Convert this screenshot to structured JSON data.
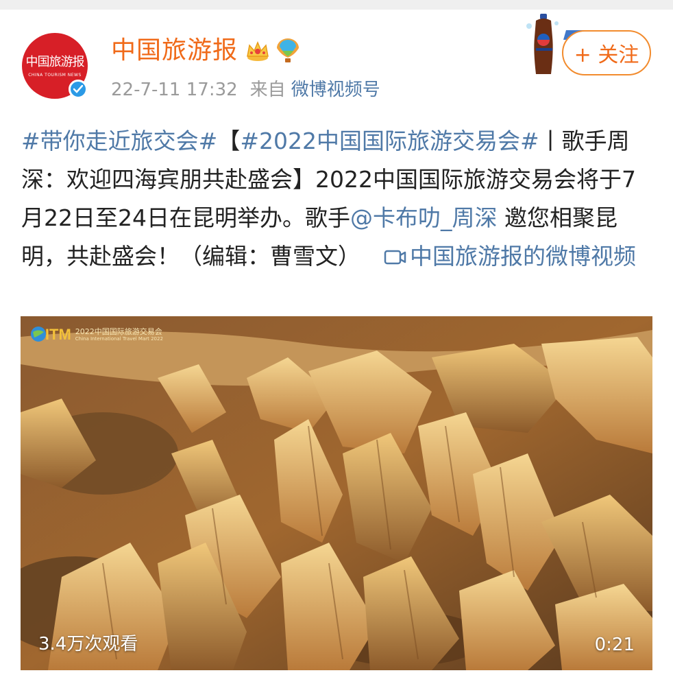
{
  "header": {
    "account_name": "中国旅游报",
    "avatar_text": "中国旅游报",
    "avatar_subtext": "CHINA TOURISM NEWS",
    "time": "22-7-11 17:32",
    "source_prefix": "来自",
    "source": "微博视频号",
    "follow_label": "+ 关注"
  },
  "post": {
    "topic1": "#带你走近旅交会#",
    "bracket_open": "【",
    "topic2": "#2022中国国际旅游交易会#",
    "headline_rest": "丨歌手周深：欢迎四海宾朋共赴盛会】",
    "body": "2022中国国际旅游交易会将于7月22日至24日在昆明举办。歌手",
    "mention": "@卡布叻_周深",
    "body2": " 邀您相聚昆明，共赴盛会！（编辑：曹雪文）",
    "video_link": "中国旅游报的微博视频"
  },
  "video": {
    "watermark_logo": "CITM",
    "watermark_cn": "2022中国国际旅游交易会",
    "watermark_en": "China International Travel Mart 2022",
    "views": "3.4万次观看",
    "duration": "0:21"
  },
  "colors": {
    "name_orange": "#f06a19",
    "link_blue": "#4f79a7",
    "meta_gray": "#9a9a9a",
    "avatar_red": "#d71f27"
  }
}
